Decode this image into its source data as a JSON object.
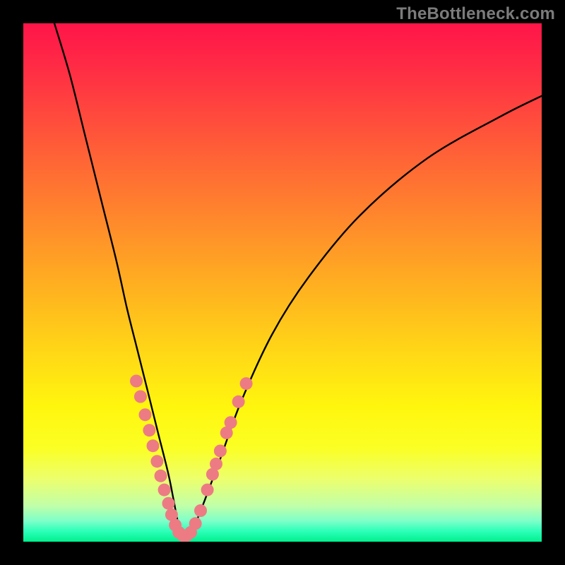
{
  "watermark": "TheBottleneck.com",
  "chart_data": {
    "type": "line",
    "title": "",
    "xlabel": "",
    "ylabel": "",
    "xlim": [
      0,
      100
    ],
    "ylim": [
      0,
      100
    ],
    "grid": false,
    "legend": false,
    "notes": "V-shaped curve on rainbow gradient; minimum near x≈30. Axes unlabeled. Values estimated from pixel positions.",
    "series": [
      {
        "name": "curve",
        "x": [
          6,
          9,
          12,
          15,
          18,
          20,
          22,
          24,
          26,
          28,
          29,
          30,
          31,
          32,
          33,
          35,
          38,
          42,
          48,
          55,
          65,
          78,
          92,
          100
        ],
        "y": [
          100,
          90,
          78,
          66,
          54,
          45,
          37,
          29,
          21,
          13,
          8,
          3,
          1,
          1,
          3,
          8,
          16,
          27,
          40,
          51,
          63,
          74,
          82,
          86
        ]
      }
    ],
    "markers": {
      "name": "highlight-dots",
      "color": "#ed7b84",
      "radius_px": 9,
      "points": [
        {
          "x": 21.8,
          "y": 31.0
        },
        {
          "x": 22.6,
          "y": 28.0
        },
        {
          "x": 23.5,
          "y": 24.5
        },
        {
          "x": 24.3,
          "y": 21.5
        },
        {
          "x": 25.0,
          "y": 18.5
        },
        {
          "x": 25.8,
          "y": 15.5
        },
        {
          "x": 26.5,
          "y": 12.7
        },
        {
          "x": 27.2,
          "y": 10.0
        },
        {
          "x": 28.0,
          "y": 7.4
        },
        {
          "x": 28.6,
          "y": 5.2
        },
        {
          "x": 29.3,
          "y": 3.2
        },
        {
          "x": 30.0,
          "y": 1.8
        },
        {
          "x": 30.8,
          "y": 1.2
        },
        {
          "x": 31.5,
          "y": 1.2
        },
        {
          "x": 32.3,
          "y": 1.8
        },
        {
          "x": 33.2,
          "y": 3.5
        },
        {
          "x": 34.2,
          "y": 6.0
        },
        {
          "x": 35.5,
          "y": 10.0
        },
        {
          "x": 36.5,
          "y": 13.0
        },
        {
          "x": 37.2,
          "y": 15.0
        },
        {
          "x": 38.0,
          "y": 17.5
        },
        {
          "x": 39.2,
          "y": 21.0
        },
        {
          "x": 40.0,
          "y": 23.0
        },
        {
          "x": 41.5,
          "y": 27.0
        },
        {
          "x": 43.0,
          "y": 30.5
        }
      ]
    }
  }
}
